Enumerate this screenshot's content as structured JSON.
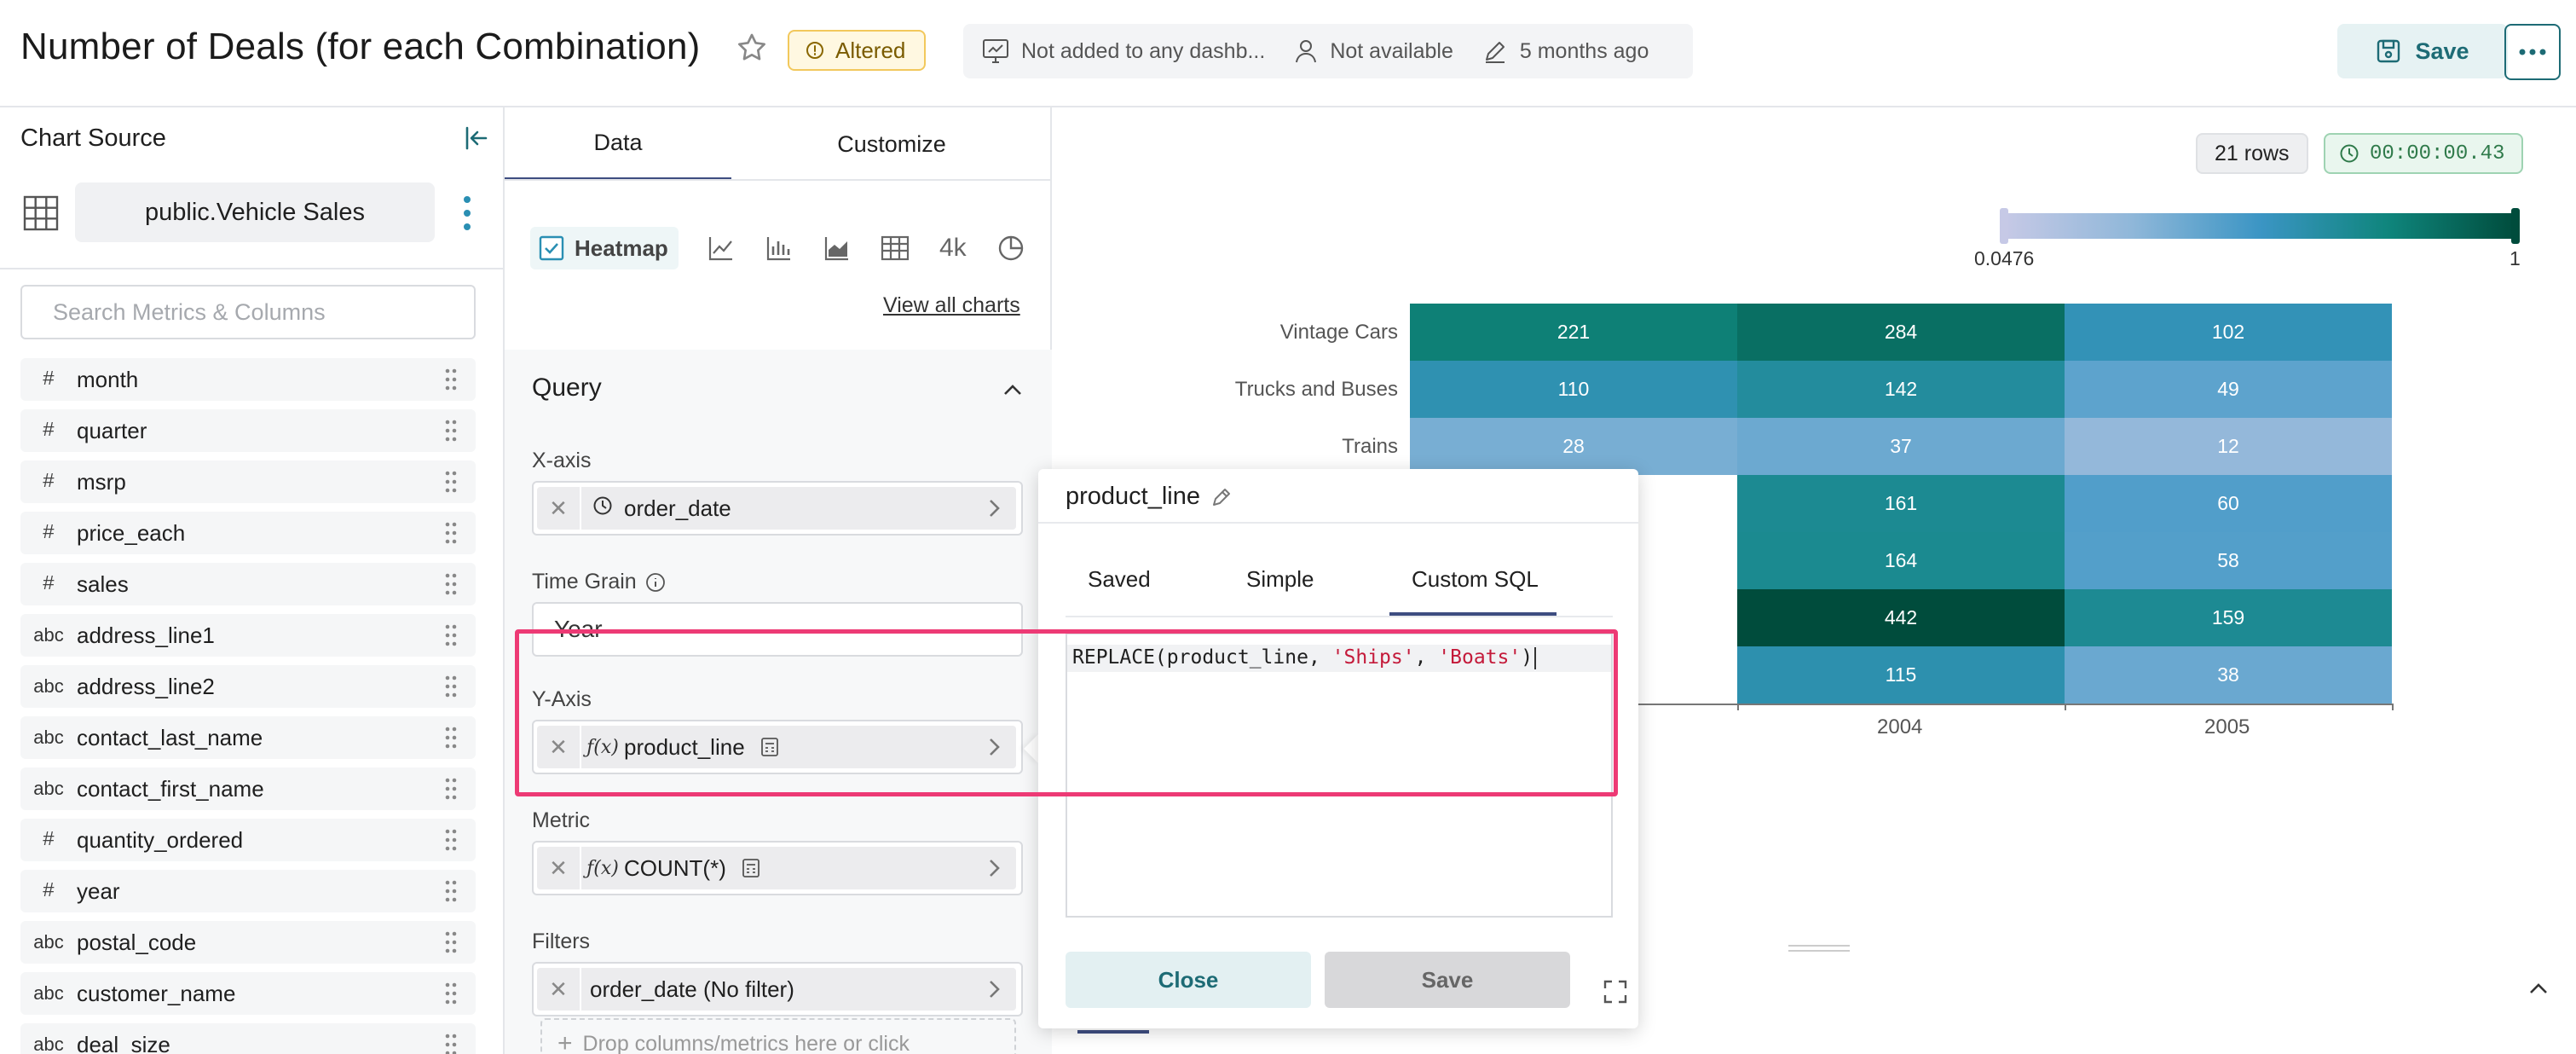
{
  "header": {
    "title": "Number of Deals (for each Combination)",
    "status_badge": "Altered",
    "dashboards": "Not added to any dashb...",
    "owner": "Not available",
    "modified": "5 months ago",
    "save_label": "Save"
  },
  "sidebar": {
    "title": "Chart Source",
    "dataset": "public.Vehicle Sales",
    "search_placeholder": "Search Metrics & Columns",
    "columns": [
      {
        "type": "#",
        "name": "month"
      },
      {
        "type": "#",
        "name": "quarter"
      },
      {
        "type": "#",
        "name": "msrp"
      },
      {
        "type": "#",
        "name": "price_each"
      },
      {
        "type": "#",
        "name": "sales"
      },
      {
        "type": "abc",
        "name": "address_line1"
      },
      {
        "type": "abc",
        "name": "address_line2"
      },
      {
        "type": "abc",
        "name": "contact_last_name"
      },
      {
        "type": "abc",
        "name": "contact_first_name"
      },
      {
        "type": "#",
        "name": "quantity_ordered"
      },
      {
        "type": "#",
        "name": "year"
      },
      {
        "type": "abc",
        "name": "postal_code"
      },
      {
        "type": "abc",
        "name": "customer_name"
      },
      {
        "type": "abc",
        "name": "deal_size"
      }
    ]
  },
  "panel": {
    "tab_data": "Data",
    "tab_customize": "Customize",
    "heatmap_label": "Heatmap",
    "bignumber_label": "4k",
    "view_all": "View all charts",
    "query_title": "Query",
    "xaxis_label": "X-axis",
    "xaxis_value": "order_date",
    "time_grain_label": "Time Grain",
    "time_grain_value": "Year",
    "yaxis_label": "Y-Axis",
    "yaxis_value": "product_line",
    "metric_label": "Metric",
    "metric_value": "COUNT(*)",
    "filters_label": "Filters",
    "filter_value": "order_date (No filter)",
    "drop_hint": "Drop columns/metrics here or click"
  },
  "results": {
    "rows": "21 rows",
    "timer": "00:00:00.43",
    "legend_min": "0.0476",
    "legend_max": "1"
  },
  "popover": {
    "title": "product_line",
    "tab_saved": "Saved",
    "tab_simple": "Simple",
    "tab_custom": "Custom SQL",
    "code_prefix": "REPLACE(product_line, ",
    "code_str1": "'Ships'",
    "code_mid": ", ",
    "code_str2": "'Boats'",
    "code_suffix": ")",
    "close_label": "Close",
    "save_label": "Save"
  },
  "colors": {
    "accent": "#1d6b75",
    "tab_underline": "#3e4d80",
    "highlight": "#ed3a75"
  },
  "chart_data": {
    "type": "heatmap",
    "x_ticks_visible": [
      "2004",
      "2005"
    ],
    "y_labels_visible": [
      "Vintage Cars",
      "Trucks and Buses",
      "Trains"
    ],
    "rows": [
      {
        "label": "Vintage Cars",
        "values": [
          221,
          284,
          102
        ]
      },
      {
        "label": "Trucks and Buses",
        "values": [
          110,
          142,
          49
        ]
      },
      {
        "label": "Trains",
        "values": [
          28,
          37,
          12
        ]
      },
      {
        "label": "",
        "values": [
          null,
          161,
          60
        ]
      },
      {
        "label": "",
        "values": [
          null,
          164,
          58
        ]
      },
      {
        "label": "",
        "values": [
          null,
          442,
          159
        ]
      },
      {
        "label": "",
        "values": [
          null,
          115,
          38
        ]
      }
    ],
    "legend_range": [
      0.0476,
      1
    ]
  }
}
